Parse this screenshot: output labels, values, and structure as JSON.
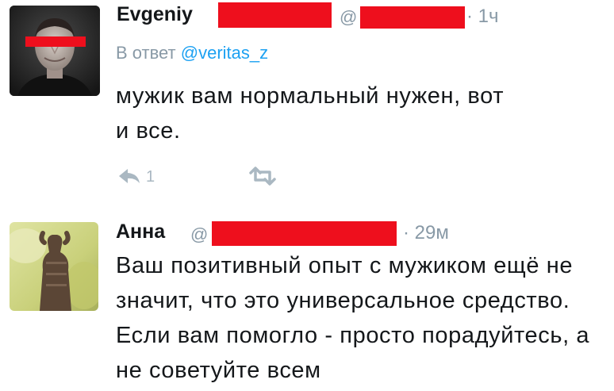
{
  "tweets": [
    {
      "author_name": "Evgeniy",
      "handle_prefix": "@",
      "time": "· 1ч",
      "reply_prefix": "В ответ",
      "reply_to": "@veritas_z",
      "text": "мужик вам нормальный нужен, вот и все.",
      "reply_count": "1",
      "actions": [
        "reply-icon",
        "retweet-icon"
      ]
    },
    {
      "author_name": "Анна",
      "handle_prefix": "@",
      "time": "· 29м",
      "text": "Ваш позитивный опыт с мужиком ещё не значит, что это универсальное средство. Если вам помогло - просто порадуйтесь, а не советуйте всем"
    }
  ],
  "colors": {
    "redaction": "#ee0f1d",
    "link": "#1da1f2",
    "muted": "#8899a6",
    "icon": "#aab8c2"
  }
}
